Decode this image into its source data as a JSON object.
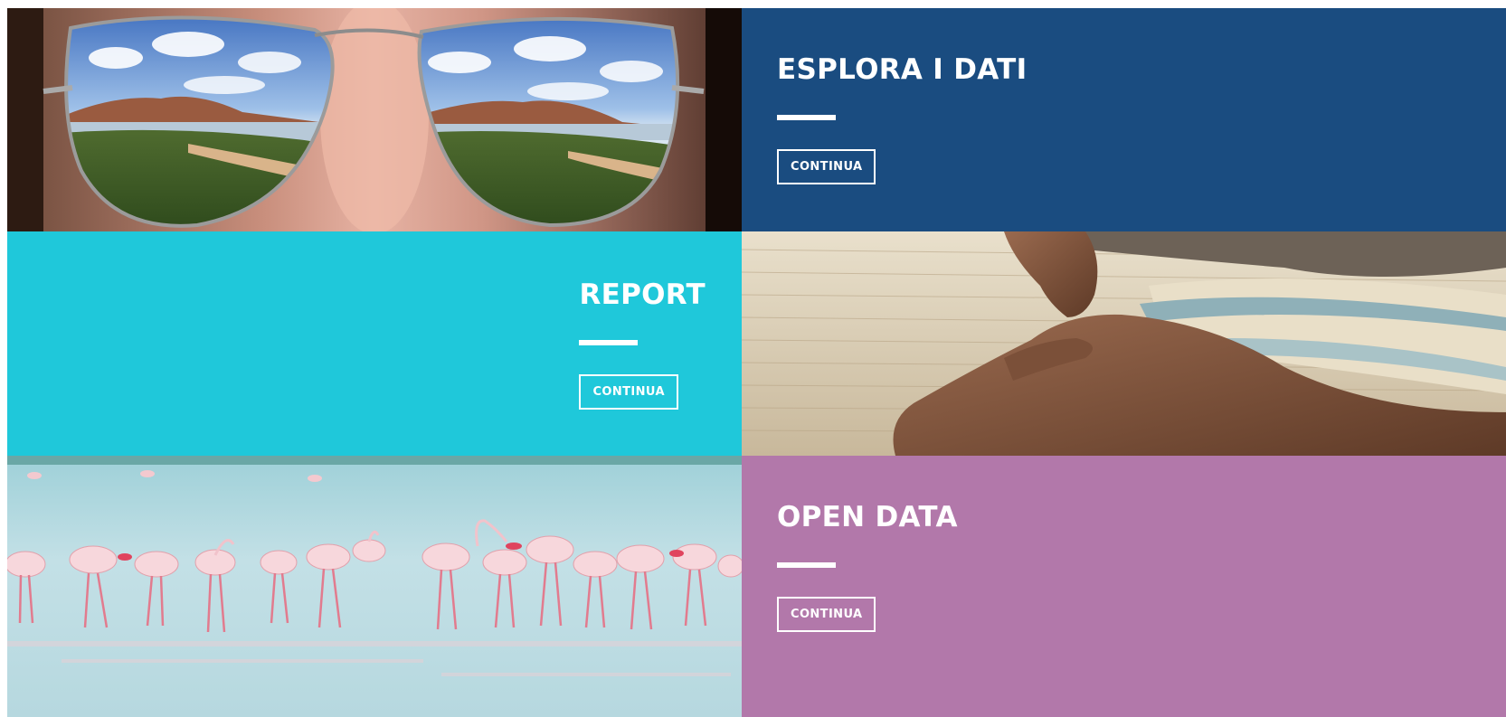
{
  "colors": {
    "esplora_bg": "#1a4c80",
    "report_bg": "#1fc8da",
    "open_data_bg": "#b278aa",
    "text": "#ffffff"
  },
  "tiles": [
    {
      "key": "esplora",
      "title": "ESPLORA I DATI",
      "button_label": "CONTINUA",
      "image": "sunglasses-beach-reflection-photo"
    },
    {
      "key": "report",
      "title": "REPORT",
      "button_label": "CONTINUA",
      "image": "hands-weaving-loom-photo"
    },
    {
      "key": "open_data",
      "title": "OPEN DATA",
      "button_label": "CONTINUA",
      "image": "flamingos-lagoon-photo"
    }
  ]
}
